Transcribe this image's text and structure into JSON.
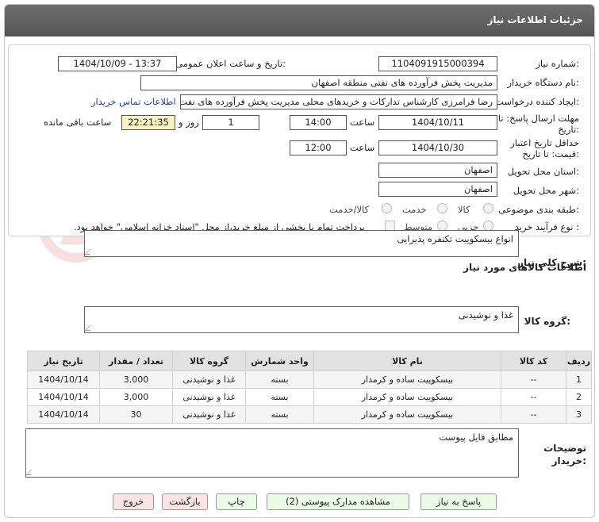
{
  "window": {
    "title": "جزئیات اطلاعات نیاز"
  },
  "form": {
    "need_number_label": "شماره نیاز:",
    "need_number": "1104091915000394",
    "announce_label": "تاریخ و ساعت اعلان عمومی:",
    "announce_value": "1404/10/09 - 13:37",
    "buyer_org_label": "نام دستگاه خریدار:",
    "buyer_org": "مدیریت پخش فرآورده های نفتی منطقه اصفهان",
    "creator_label": "ایجاد کننده درخواست:",
    "creator": "رضا فرامرزی کارشناس تدارکات و خریدهای محلی مدیریت پخش فرآورده های نفت",
    "contact_link": "اطلاعات تماس خریدار",
    "deadline_label": "مهلت ارسال پاسخ: تا تاریخ:",
    "deadline_date": "1404/10/11",
    "time_label": "ساعت",
    "deadline_time": "14:00",
    "days_value": "1",
    "days_label": "روز و",
    "remaining_time": "22:21:35",
    "remaining_label": "ساعت باقی مانده",
    "validity_label": "حداقل تاریخ اعتبار قیمت: تا تاریخ:",
    "validity_date": "1404/10/30",
    "validity_time": "12:00",
    "province_label": "استان محل تحویل:",
    "province": "اصفهان",
    "city_label": "شهر محل تحویل:",
    "city": "اصفهان",
    "category_label": "طبقه بندی موضوعی:",
    "category_options": [
      "کالا",
      "خدمت",
      "کالا/خدمت"
    ],
    "process_label": "نوع فرآیند خرید :",
    "process_options": [
      "جزیی",
      "متوسط"
    ],
    "payment_note": "پرداخت تمام یا بخشی از مبلغ خرید،از محل \"اسناد خزانه اسلامی\" خواهد بود."
  },
  "description": {
    "label": "شرح کلی نیاز:",
    "value": "انواع بیسکوییت تکنفره پذیرایی"
  },
  "goods": {
    "section_label": "اطلاعات کالاهای مورد نیاز",
    "group_label": "گروه کالا:",
    "group_value": "غذا و نوشیدنی",
    "columns": [
      "ردیف",
      "کد کالا",
      "نام کالا",
      "واحد شمارش",
      "گروه کالا",
      "تعداد / مقدار",
      "تاریخ نیاز"
    ],
    "rows": [
      {
        "row": "1",
        "code": "--",
        "name": "بیسکوییت ساده و کرمدار",
        "unit": "بسته",
        "group": "غذا و نوشیدنی",
        "qty": "3,000",
        "date": "1404/10/14"
      },
      {
        "row": "2",
        "code": "--",
        "name": "بیسکوییت ساده و کرمدار",
        "unit": "بسته",
        "group": "غذا و نوشیدنی",
        "qty": "3,000",
        "date": "1404/10/14"
      },
      {
        "row": "3",
        "code": "--",
        "name": "بیسکوییت ساده و کرمدار",
        "unit": "بسته",
        "group": "غذا و نوشیدنی",
        "qty": "30",
        "date": "1404/10/14"
      }
    ]
  },
  "buyer_notes": {
    "label_line1": "توضیحات",
    "label_line2": "خریدار:",
    "value": "مطابق فایل پیوست"
  },
  "buttons": {
    "reply": "پاسخ به نیاز",
    "attachments": "مشاهده مدارک پیوستی (2)",
    "print": "چاپ",
    "back": "بازگشت",
    "exit": "خروج"
  },
  "watermark": {
    "text": "AriaTender.net"
  },
  "colors": {
    "link": "#1a3fcc",
    "remaining_bg": "#f8f2c4",
    "button_green": "#eafbe5",
    "button_pink": "#fbe3e3"
  }
}
